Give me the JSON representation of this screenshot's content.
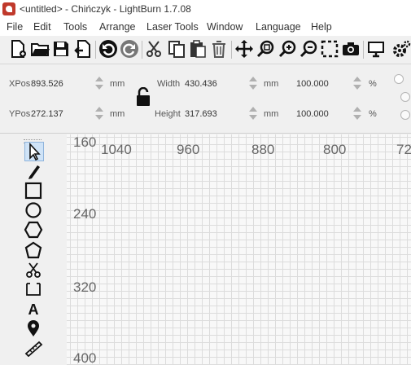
{
  "window": {
    "title": "<untitled> - Chińczyk - LightBurn 1.7.08"
  },
  "menu": {
    "items": [
      "File",
      "Edit",
      "Tools",
      "Arrange",
      "Laser Tools",
      "Window",
      "Language",
      "Help"
    ]
  },
  "toolbar": {
    "icons": [
      "new-file-icon",
      "open-folder-icon",
      "save-icon",
      "export-icon",
      "undo-icon",
      "redo-icon",
      "cut-icon",
      "copy-icon",
      "paste-icon",
      "delete-icon",
      "move-icon",
      "zoom-selection-icon",
      "zoom-in-icon",
      "zoom-out-icon",
      "frame-icon",
      "camera-icon",
      "monitor-icon",
      "settings-icon"
    ]
  },
  "numeric": {
    "xpos_label": "XPos",
    "xpos_value": "893.526",
    "ypos_label": "YPos",
    "ypos_value": "272.137",
    "unit": "mm",
    "width_label": "Width",
    "width_value": "430.436",
    "height_label": "Height",
    "height_value": "317.693",
    "scale_w": "100.000",
    "scale_h": "100.000",
    "percent": "%"
  },
  "tools": {
    "icons": [
      "select-icon",
      "edit-nodes-icon",
      "rectangle-icon",
      "ellipse-icon",
      "polygon-icon",
      "polygon-alt-icon",
      "trim-icon",
      "frame-icon",
      "text-icon",
      "position-icon",
      "measure-icon"
    ]
  },
  "ruler": {
    "top": [
      "1040",
      "960",
      "880",
      "800",
      "72"
    ],
    "left": [
      "160",
      "240",
      "320",
      "400"
    ]
  },
  "colors": {
    "accent": "#c0392b",
    "selected_tool_bg": "#cfe3f7",
    "grid_line": "#dcdcdc"
  }
}
